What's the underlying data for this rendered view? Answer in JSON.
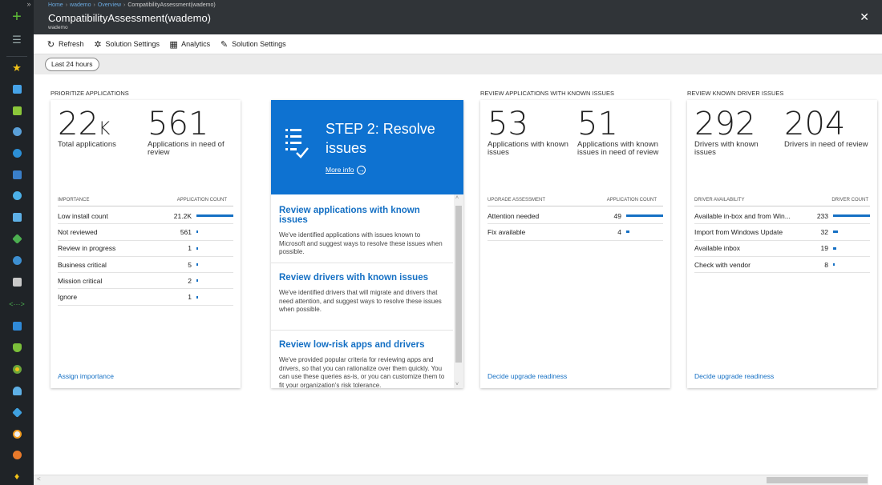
{
  "breadcrumb": [
    "Home",
    "wademo",
    "Overview",
    "CompatibilityAssessment(wademo)"
  ],
  "blade": {
    "title": "CompatibilityAssessment(wademo)",
    "subtitle": "wademo"
  },
  "toolbar": [
    "Refresh",
    "Solution Settings",
    "Analytics",
    "Solution Settings"
  ],
  "filter": {
    "time_range": "Last 24 hours"
  },
  "prioritize": {
    "heading": "PRIORITIZE APPLICATIONS",
    "kpi1_value": "22",
    "kpi1_unit": "K",
    "kpi1_label": "Total applications",
    "kpi2_value": "561",
    "kpi2_label": "Applications in need of review",
    "col1": "IMPORTANCE",
    "col2": "APPLICATION COUNT",
    "rows": [
      {
        "label": "Low install count",
        "count": "21.2K",
        "fill": 1.0
      },
      {
        "label": "Not reviewed",
        "count": "561",
        "fill": 0.03
      },
      {
        "label": "Review in progress",
        "count": "1",
        "fill": 0.01
      },
      {
        "label": "Business critical",
        "count": "5",
        "fill": 0.01
      },
      {
        "label": "Mission critical",
        "count": "2",
        "fill": 0.01
      },
      {
        "label": "Ignore",
        "count": "1",
        "fill": 0.01
      }
    ],
    "footer_link": "Assign importance"
  },
  "step": {
    "title": "STEP 2: Resolve issues",
    "more_info": "More info",
    "items": [
      {
        "title": "Review applications with known issues",
        "text": "We've identified applications with issues known to Microsoft and suggest ways to resolve these issues when possible."
      },
      {
        "title": "Review drivers with known issues",
        "text": "We've identified drivers that will migrate and drivers that need attention, and suggest ways to resolve these issues when possible."
      },
      {
        "title": "Review low-risk apps and drivers",
        "text": "We've provided popular criteria for reviewing apps and drivers, so that you can rationalize over them quickly. You can use these queries as-is, or you can customize them to fit your organization's risk tolerance."
      }
    ]
  },
  "apps_known": {
    "heading": "REVIEW APPLICATIONS WITH KNOWN ISSUES",
    "kpi1_value": "53",
    "kpi1_label": "Applications with known issues",
    "kpi2_value": "51",
    "kpi2_label": "Applications with known issues in need of review",
    "col1": "UPGRADE ASSESSMENT",
    "col2": "APPLICATION COUNT",
    "rows": [
      {
        "label": "Attention needed",
        "count": "49",
        "fill": 1.0
      },
      {
        "label": "Fix available",
        "count": "4",
        "fill": 0.08
      }
    ],
    "footer_link": "Decide upgrade readiness"
  },
  "drivers_known": {
    "heading": "REVIEW KNOWN DRIVER ISSUES",
    "kpi1_value": "292",
    "kpi1_label": "Drivers with known issues",
    "kpi2_value": "204",
    "kpi2_label": "Drivers in need of review",
    "col1": "DRIVER AVAILABILITY",
    "col2": "DRIVER COUNT",
    "rows": [
      {
        "label": "Available in-box and from Win...",
        "count": "233",
        "fill": 1.0
      },
      {
        "label": "Import from Windows Update",
        "count": "32",
        "fill": 0.14
      },
      {
        "label": "Available inbox",
        "count": "19",
        "fill": 0.08
      },
      {
        "label": "Check with vendor",
        "count": "8",
        "fill": 0.03
      }
    ],
    "footer_link": "Decide upgrade readiness"
  },
  "colors": {
    "accent": "#0e72d1",
    "bar": "#1570c4",
    "rail": "#1f2327",
    "header": "#303438"
  }
}
